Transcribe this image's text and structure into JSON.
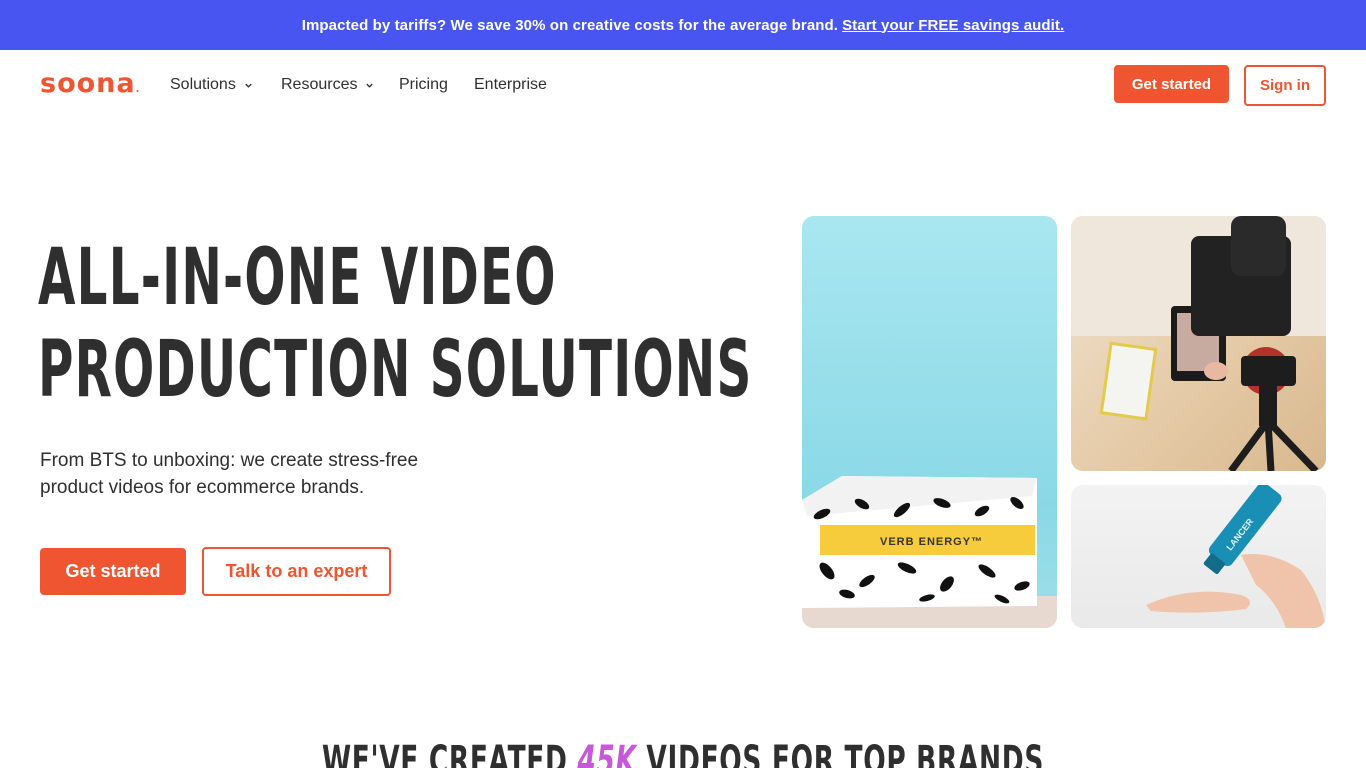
{
  "banner": {
    "text": "Impacted by tariffs? We save 30% on creative costs for the average brand.",
    "cta": "Start your FREE savings audit."
  },
  "nav": {
    "logo": "soona",
    "items": [
      {
        "label": "Solutions",
        "has_dropdown": true
      },
      {
        "label": "Resources",
        "has_dropdown": true
      },
      {
        "label": "Pricing",
        "has_dropdown": false
      },
      {
        "label": "Enterprise",
        "has_dropdown": false
      }
    ],
    "get_started": "Get started",
    "sign_in": "Sign in"
  },
  "hero": {
    "title_line1": "ALL-IN-ONE VIDEO",
    "title_line2": "PRODUCTION SOLUTIONS",
    "subtitle": "From BTS to unboxing: we create stress-free product videos for ecommerce brands.",
    "primary_cta": "Get started",
    "secondary_cta": "Talk to an expert"
  },
  "media": {
    "box_label": "VERB ENERGY™",
    "tube_label": "LANCER"
  },
  "section": {
    "title_prefix": "WE'VE CREATED",
    "title_highlight": "45K",
    "title_suffix": "VIDEOS FOR TOP BRANDS"
  },
  "colors": {
    "banner": "#4855f0",
    "accent": "#ef5530",
    "text": "#2f2f2f",
    "highlight": "#c759d8"
  }
}
